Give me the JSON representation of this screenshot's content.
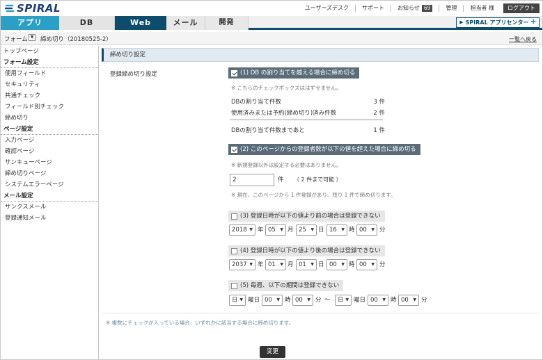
{
  "brand": {
    "logo_text": "SPIRAL"
  },
  "toplinks": {
    "user_desk": "ユーザーズデスク",
    "support": "サポート",
    "notice": "お知らせ",
    "notice_count": "69",
    "admin": "管理",
    "user": "担当者 様",
    "logout": "ログアウト"
  },
  "nav": {
    "app": "アプリ",
    "db": "DB",
    "web": "Web",
    "mail": "メール",
    "dev": "開発"
  },
  "app_center": "SPIRAL アプリセンター",
  "breadcrumb": {
    "form": "フォーム",
    "title": "締め切り（20180525-2）",
    "back": "一覧へ戻る"
  },
  "sidebar": {
    "top": "トップページ",
    "form_settings": "フォーム設定",
    "form_items": [
      "使用フィールド",
      "セキュリティ",
      "共通チェック",
      "フィールド別チェック",
      "締め切り"
    ],
    "page_settings": "ページ設定",
    "page_items": [
      "入力ページ",
      "確認ページ",
      "サンキューページ",
      "締め切りページ",
      "システムエラーページ"
    ],
    "mail_settings": "メール設定",
    "mail_items": [
      "サンクスメール",
      "登録通知メール"
    ]
  },
  "main": {
    "section_title": "締め切り設定",
    "reg_label": "登録締め切り設定",
    "c1": {
      "label": "(1) DB の割り当てを越える場合に締め切る",
      "note": "※ こちらのチェックボックスははずせません。"
    },
    "stats": [
      {
        "label": "DBの割り当て件数",
        "value": "3 件"
      },
      {
        "label": "使用済みまたは予約(締め切り)済み件数",
        "value": "2 件"
      },
      {
        "label": "DBの割り当て件数まであと",
        "value": "1 件"
      }
    ],
    "c2": {
      "label": "(2) このページからの登録者数が以下の値を超えた場合に締め切る",
      "note": "※ 新規登録以外は設定する必要はありません。",
      "input_value": "2",
      "unit": "件",
      "hint": "（ 2 件まで可能 ）",
      "note2": "※ 現在、このページから 1 件登録があり、残り 1 件で締め切ります。"
    },
    "c3": {
      "label": "(3) 登録日時が以下の値より前の場合は登録できない",
      "year": "2018",
      "month": "05",
      "day": "25",
      "hour": "16",
      "minute": "00"
    },
    "c4": {
      "label": "(4) 登録日時が以下の値より後の場合は登録できない",
      "year": "2037",
      "month": "01",
      "day": "01",
      "hour": "00",
      "minute": "00"
    },
    "c5": {
      "label": "(5) 毎週、以下の期間は登録できない",
      "from_wd": "日",
      "from_h": "00",
      "from_m": "00",
      "to_wd": "日",
      "to_h": "00",
      "to_m": "00"
    },
    "units": {
      "year": "年",
      "month": "月",
      "day": "日",
      "hour": "時",
      "minute": "分",
      "weekday": "曜日",
      "tilde": "～"
    },
    "footer_note": "※ 複数にチェックが入っている場合、いずれかに該当する場合に締め切ります。",
    "change_button": "変更"
  }
}
